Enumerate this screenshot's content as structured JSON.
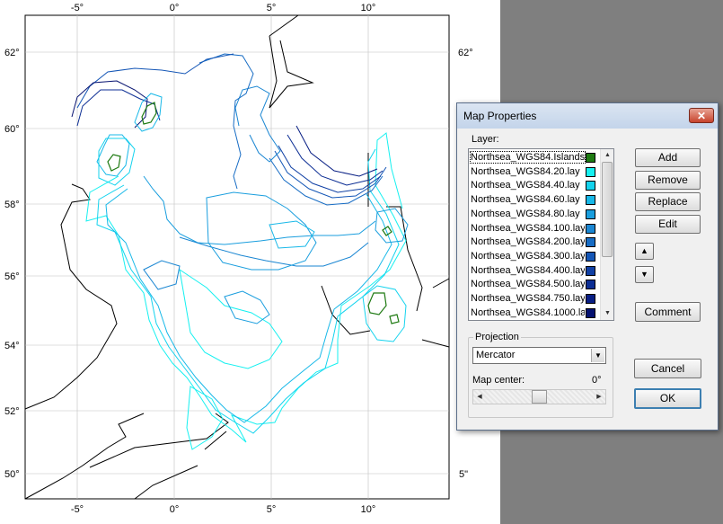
{
  "map": {
    "lon_labels": [
      "-5°",
      "0°",
      "5°",
      "10°"
    ],
    "lat_labels": [
      "62°",
      "60°",
      "58°",
      "56°",
      "54°",
      "52°",
      "50°"
    ],
    "right_lat_label": "62°",
    "right_cutoff_label": "5\""
  },
  "dialog": {
    "title": "Map Properties",
    "close_glyph": "✕",
    "layer_label": "Layer:",
    "layers": [
      {
        "name": "Northsea_WGS84.Islands.",
        "color": "#1e7a12"
      },
      {
        "name": "Northsea_WGS84.20.lay",
        "color": "#16f0f0"
      },
      {
        "name": "Northsea_WGS84.40.lay",
        "color": "#14d3ee"
      },
      {
        "name": "Northsea_WGS84.60.lay",
        "color": "#18b8e8"
      },
      {
        "name": "Northsea_WGS84.80.lay",
        "color": "#1a9ede"
      },
      {
        "name": "Northsea_WGS84.100.lay",
        "color": "#1a86d2"
      },
      {
        "name": "Northsea_WGS84.200.lay",
        "color": "#176cc4"
      },
      {
        "name": "Northsea_WGS84.300.lay",
        "color": "#1456b6"
      },
      {
        "name": "Northsea_WGS84.400.lay",
        "color": "#1040a4"
      },
      {
        "name": "Northsea_WGS84.500.lay",
        "color": "#0c2e94"
      },
      {
        "name": "Northsea_WGS84.750.lay",
        "color": "#081f84"
      },
      {
        "name": "Northsea_WGS84.1000.la",
        "color": "#061270"
      }
    ],
    "buttons": {
      "add": "Add",
      "remove": "Remove",
      "replace": "Replace",
      "edit": "Edit",
      "comment": "Comment",
      "cancel": "Cancel",
      "ok": "OK"
    },
    "projection_label": "Projection",
    "projection_value": "Mercator",
    "map_center_label": "Map center:",
    "map_center_value": "0°",
    "map_center_fraction": 0.5
  }
}
